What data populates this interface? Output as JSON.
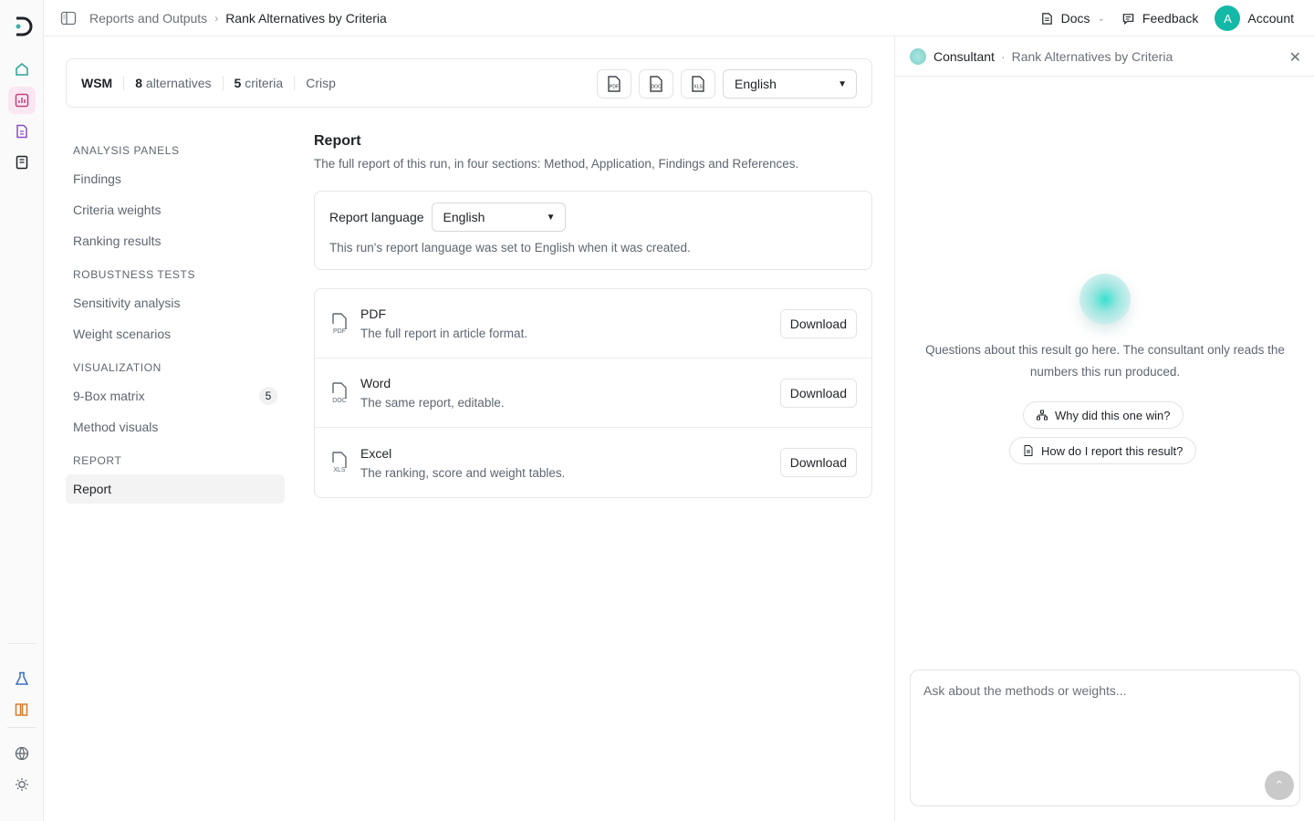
{
  "rail": {
    "icons": [
      "home-icon",
      "chart-icon",
      "document-icon",
      "book-icon",
      "flask-icon",
      "library-icon",
      "globe-icon",
      "sun-icon"
    ]
  },
  "topbar": {
    "breadcrumb": [
      "Reports and Outputs",
      "Rank Alternatives by Criteria"
    ],
    "docs_label": "Docs",
    "feedback_label": "Feedback",
    "avatar_initial": "A",
    "account_label": "Account"
  },
  "summary": {
    "method": "WSM",
    "alt_count": "8",
    "alt_label": "alternatives",
    "crit_count": "5",
    "crit_label": "criteria",
    "mode": "Crisp",
    "export_icons": [
      "PDF",
      "DOC",
      "XLS"
    ],
    "language": "English"
  },
  "nav": {
    "sections": [
      {
        "heading": "ANALYSIS PANELS",
        "items": [
          {
            "label": "Findings"
          },
          {
            "label": "Criteria weights"
          },
          {
            "label": "Ranking results"
          }
        ]
      },
      {
        "heading": "ROBUSTNESS TESTS",
        "items": [
          {
            "label": "Sensitivity analysis"
          },
          {
            "label": "Weight scenarios"
          }
        ]
      },
      {
        "heading": "VISUALIZATION",
        "items": [
          {
            "label": "9-Box matrix",
            "badge": "5"
          },
          {
            "label": "Method visuals"
          }
        ]
      },
      {
        "heading": "REPORT",
        "items": [
          {
            "label": "Report",
            "active": true
          }
        ]
      }
    ]
  },
  "report": {
    "title": "Report",
    "subtitle": "The full report of this run, in four sections: Method, Application, Findings and References.",
    "language_label": "Report language",
    "language_value": "English",
    "language_note": "This run's report language was set to English when it was created.",
    "files": [
      {
        "tag": "PDF",
        "name": "PDF",
        "desc": "The full report in article format.",
        "button": "Download"
      },
      {
        "tag": "DOC",
        "name": "Word",
        "desc": "The same report, editable.",
        "button": "Download"
      },
      {
        "tag": "XLS",
        "name": "Excel",
        "desc": "The ranking, score and weight tables.",
        "button": "Download"
      }
    ]
  },
  "consultant": {
    "title": "Consultant",
    "subtitle": "Rank Alternatives by Criteria",
    "message": "Questions about this result go here. The consultant only reads the numbers this run produced.",
    "suggestions": [
      "Why did this one win?",
      "How do I report this result?"
    ],
    "input_placeholder": "Ask about the methods or weights..."
  },
  "colors": {
    "accent": "#14b8a6",
    "active_rail": "#fbe7f1"
  }
}
